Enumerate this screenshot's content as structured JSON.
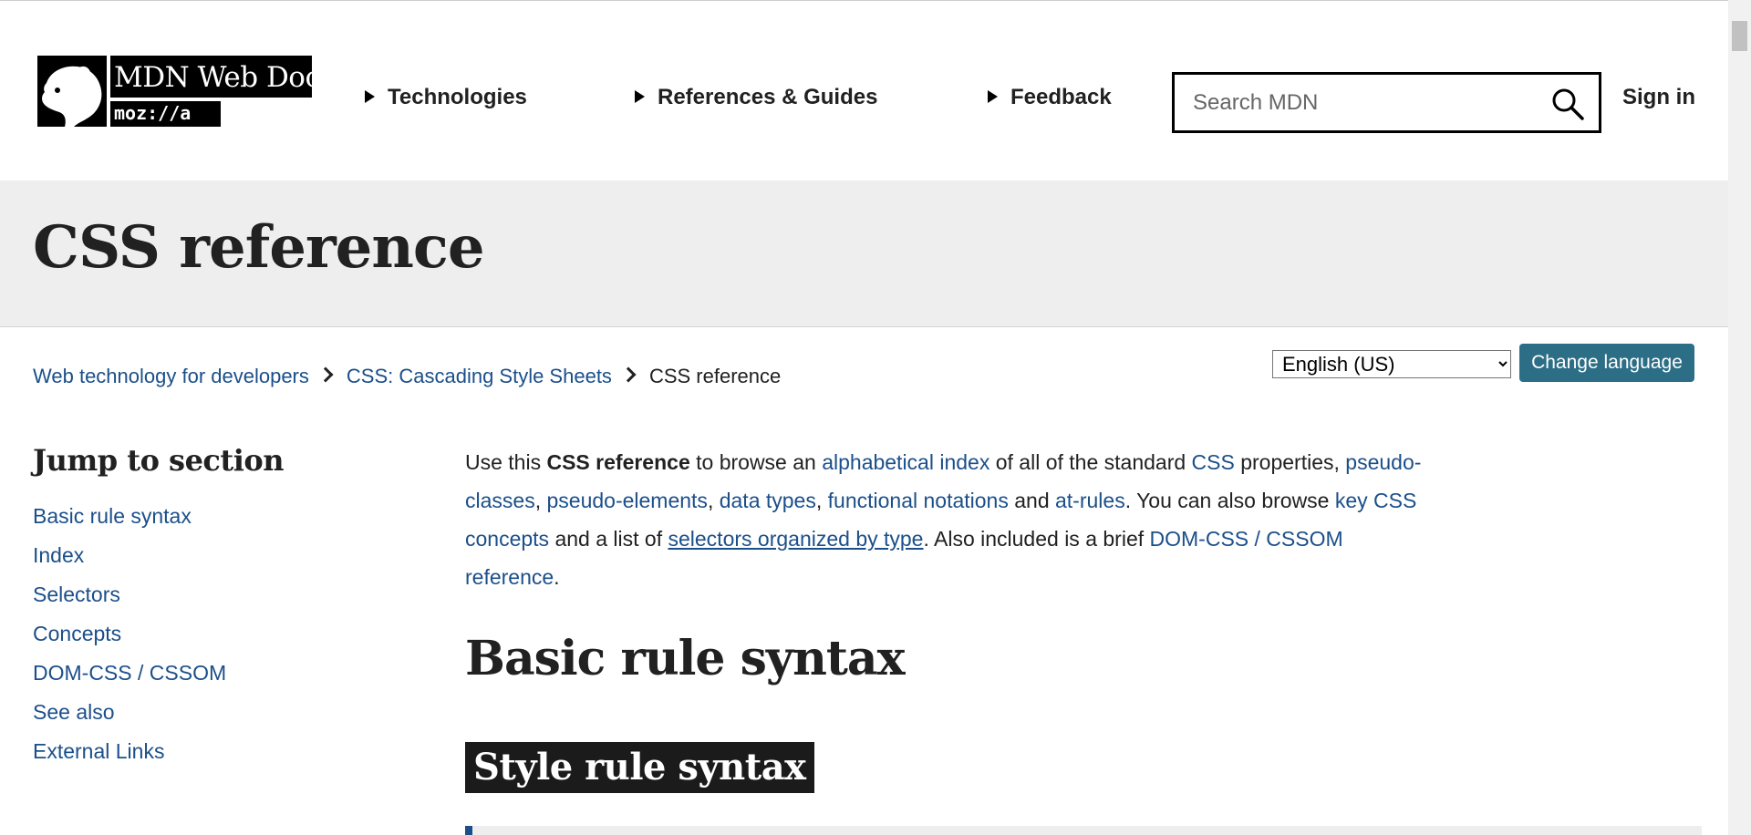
{
  "header": {
    "logo": {
      "title": "MDN Web Docs",
      "moz": "moz://a"
    },
    "nav": [
      {
        "label": "Technologies"
      },
      {
        "label": "References & Guides"
      },
      {
        "label": "Feedback"
      }
    ],
    "search": {
      "placeholder": "Search MDN"
    },
    "sign_in": "Sign in"
  },
  "page": {
    "title": "CSS reference"
  },
  "breadcrumb": {
    "items": [
      "Web technology for developers",
      "CSS: Cascading Style Sheets"
    ],
    "current": "CSS reference"
  },
  "language": {
    "selected": "English (US)",
    "button": "Change language"
  },
  "sidebar": {
    "title": "Jump to section",
    "items": [
      "Basic rule syntax",
      "Index",
      "Selectors",
      "Concepts",
      "DOM-CSS / CSSOM",
      "See also",
      "External Links"
    ]
  },
  "intro": {
    "t1": "Use this ",
    "b1": "CSS reference",
    "t2": " to browse an ",
    "l_alpha": "alphabetical index",
    "t3": " of all of the standard ",
    "l_css": "CSS",
    "t4": " properties, ",
    "l_pc": "pseudo-classes",
    "c1": ", ",
    "l_pe": "pseudo-elements",
    "c2": ", ",
    "l_dt": "data types",
    "c3": ", ",
    "l_fn": "functional notations",
    "t5": " and ",
    "l_ar": "at-rules",
    "t6": ". You can also browse ",
    "l_key": "key CSS concepts",
    "t7": " and a list of ",
    "l_sel": "selectors organized by type",
    "t8": ". Also included is a brief ",
    "l_dom": "DOM-CSS / CSSOM reference",
    "t9": "."
  },
  "sections": {
    "h2": "Basic rule syntax",
    "h3": "Style rule syntax"
  },
  "colors": {
    "link": "#1b4f8a",
    "button": "#2c6e86",
    "band": "#eeeeee"
  }
}
